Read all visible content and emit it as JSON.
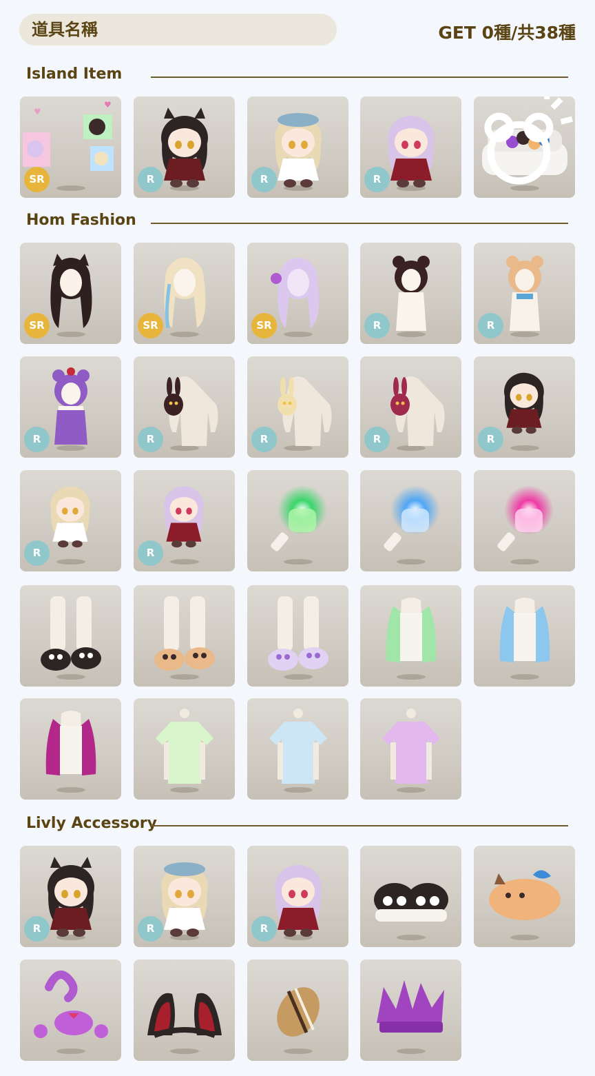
{
  "header": {
    "search_value": "道具名稱",
    "count_text": "GET 0種/共38種"
  },
  "sections": [
    {
      "title": "Island Item",
      "items": [
        {
          "name": "photo-frames",
          "rarity": "SR",
          "art": "frames"
        },
        {
          "name": "chibi-maid-cat-girl",
          "rarity": "R",
          "art": "chibi-dark"
        },
        {
          "name": "chibi-blonde-girl",
          "rarity": "R",
          "art": "chibi-blonde"
        },
        {
          "name": "chibi-lavender-girl",
          "rarity": "R",
          "art": "chibi-lavender"
        },
        {
          "name": "white-sofa",
          "rarity": "",
          "art": "sofa",
          "new": true
        }
      ]
    },
    {
      "title": "Hom Fashion",
      "items": [
        {
          "name": "black-cat-ear-hair",
          "rarity": "SR",
          "art": "hair-black"
        },
        {
          "name": "blonde-wavy-hair",
          "rarity": "SR",
          "art": "hair-blonde"
        },
        {
          "name": "lavender-curly-hair",
          "rarity": "SR",
          "art": "hair-lavender"
        },
        {
          "name": "black-bear-hood",
          "rarity": "R",
          "art": "hood-black"
        },
        {
          "name": "shiba-hood",
          "rarity": "R",
          "art": "hood-shiba"
        },
        {
          "name": "purple-hoodie",
          "rarity": "R",
          "art": "hoodie-purple"
        },
        {
          "name": "bunny-plush-shoulder",
          "rarity": "R",
          "art": "shoulder-bunny-dark"
        },
        {
          "name": "bunny-plush-shoulder-cream",
          "rarity": "R",
          "art": "shoulder-bunny-cream"
        },
        {
          "name": "bunny-plush-shoulder-red",
          "rarity": "R",
          "art": "shoulder-bunny-red"
        },
        {
          "name": "maid-chibi-shoulder",
          "rarity": "R",
          "art": "shoulder-chibi-dark"
        },
        {
          "name": "blonde-chibi-shoulder",
          "rarity": "R",
          "art": "shoulder-chibi-blonde"
        },
        {
          "name": "lavender-chibi-shoulder",
          "rarity": "R",
          "art": "shoulder-chibi-lavender"
        },
        {
          "name": "green-glow-stick",
          "rarity": "",
          "art": "wand-green"
        },
        {
          "name": "blue-glow-stick",
          "rarity": "",
          "art": "wand-blue"
        },
        {
          "name": "pink-glow-stick",
          "rarity": "",
          "art": "wand-pink"
        },
        {
          "name": "cat-slippers-black",
          "rarity": "",
          "art": "slippers-black"
        },
        {
          "name": "cat-slippers-shiba",
          "rarity": "",
          "art": "slippers-shiba"
        },
        {
          "name": "cat-slippers-lavender",
          "rarity": "",
          "art": "slippers-lavender"
        },
        {
          "name": "green-jacket",
          "rarity": "",
          "art": "jacket-green"
        },
        {
          "name": "blue-jacket",
          "rarity": "",
          "art": "jacket-blue"
        },
        {
          "name": "magenta-jacket",
          "rarity": "",
          "art": "jacket-magenta"
        },
        {
          "name": "green-tshirt",
          "rarity": "",
          "art": "tee-green"
        },
        {
          "name": "blue-tshirt",
          "rarity": "",
          "art": "tee-blue"
        },
        {
          "name": "purple-tshirt",
          "rarity": "",
          "art": "tee-purple"
        }
      ]
    },
    {
      "title": "Livly Accessory",
      "items": [
        {
          "name": "maid-cat-girl-doll",
          "rarity": "R",
          "art": "chibi-dark"
        },
        {
          "name": "blonde-girl-doll",
          "rarity": "R",
          "art": "chibi-blonde"
        },
        {
          "name": "lavender-girl-doll",
          "rarity": "R",
          "art": "chibi-lavender"
        },
        {
          "name": "twin-black-cats",
          "rarity": "",
          "art": "twin-cats"
        },
        {
          "name": "shiba-plush",
          "rarity": "",
          "art": "shiba-plush"
        },
        {
          "name": "purple-scorpion",
          "rarity": "",
          "art": "scorpion"
        },
        {
          "name": "black-cat-ears",
          "rarity": "",
          "art": "cat-ears"
        },
        {
          "name": "sunflower-seed",
          "rarity": "",
          "art": "seed"
        },
        {
          "name": "purple-crown",
          "rarity": "",
          "art": "crown"
        }
      ]
    }
  ],
  "colors": {
    "background": "#f4f7fb",
    "text": "#5a4414",
    "sr_badge": "#e7b53c",
    "r_badge": "#8fc7cb",
    "tile": "#d4d0c9"
  }
}
